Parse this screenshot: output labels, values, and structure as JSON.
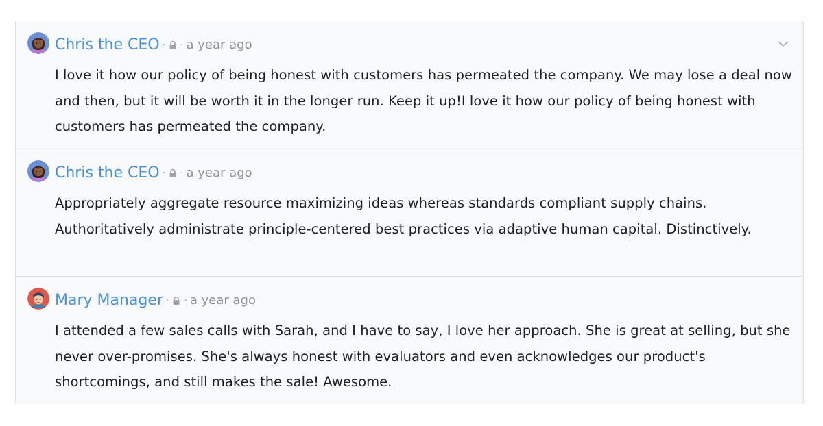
{
  "comments": [
    {
      "author": "Chris the CEO",
      "separator": "·",
      "time": "a year ago",
      "avatar_icon": "person-avatar-icon",
      "avatar_colors": {
        "bg": "#6b8fd6",
        "skin": "#8a5a3c",
        "hair": "#3b2417",
        "shirt": "#b37bd6"
      },
      "text": "I love it how our policy of being honest with customers has permeated the company. We may lose a deal now and then, but it will be worth it in the longer run. Keep it up!I love it how our policy of being honest with customers has permeated the company."
    },
    {
      "author": "Chris the CEO",
      "separator": "·",
      "time": "a year ago",
      "avatar_icon": "person-avatar-icon",
      "avatar_colors": {
        "bg": "#6b8fd6",
        "skin": "#8a5a3c",
        "hair": "#3b2417",
        "shirt": "#b37bd6"
      },
      "text": "Appropriately aggregate resource maximizing ideas whereas standards compliant supply chains. Authoritatively administrate principle-centered best practices via adaptive human capital. Distinctively."
    },
    {
      "author": "Mary Manager",
      "separator": "·",
      "time": "a year ago",
      "avatar_icon": "person-avatar-icon",
      "avatar_colors": {
        "bg": "#e2574c",
        "skin": "#f1c7a4",
        "hair": "#27455f",
        "shirt": "#4a7fa8"
      },
      "text": "I attended a few sales calls with Sarah, and I have to say, I love her approach. She is great at selling, but she never over-promises. She's always honest with evaluators and even acknowledges our product's shortcomings, and still makes the sale! Awesome."
    }
  ],
  "icons": {
    "lock": "lock-icon",
    "chevron": "chevron-down-icon"
  },
  "colors": {
    "author_link": "#4a90d9",
    "muted": "#8f949b",
    "body_text": "#1d2024",
    "card_bg": "#f8f9fb",
    "border": "#dde0e5"
  }
}
